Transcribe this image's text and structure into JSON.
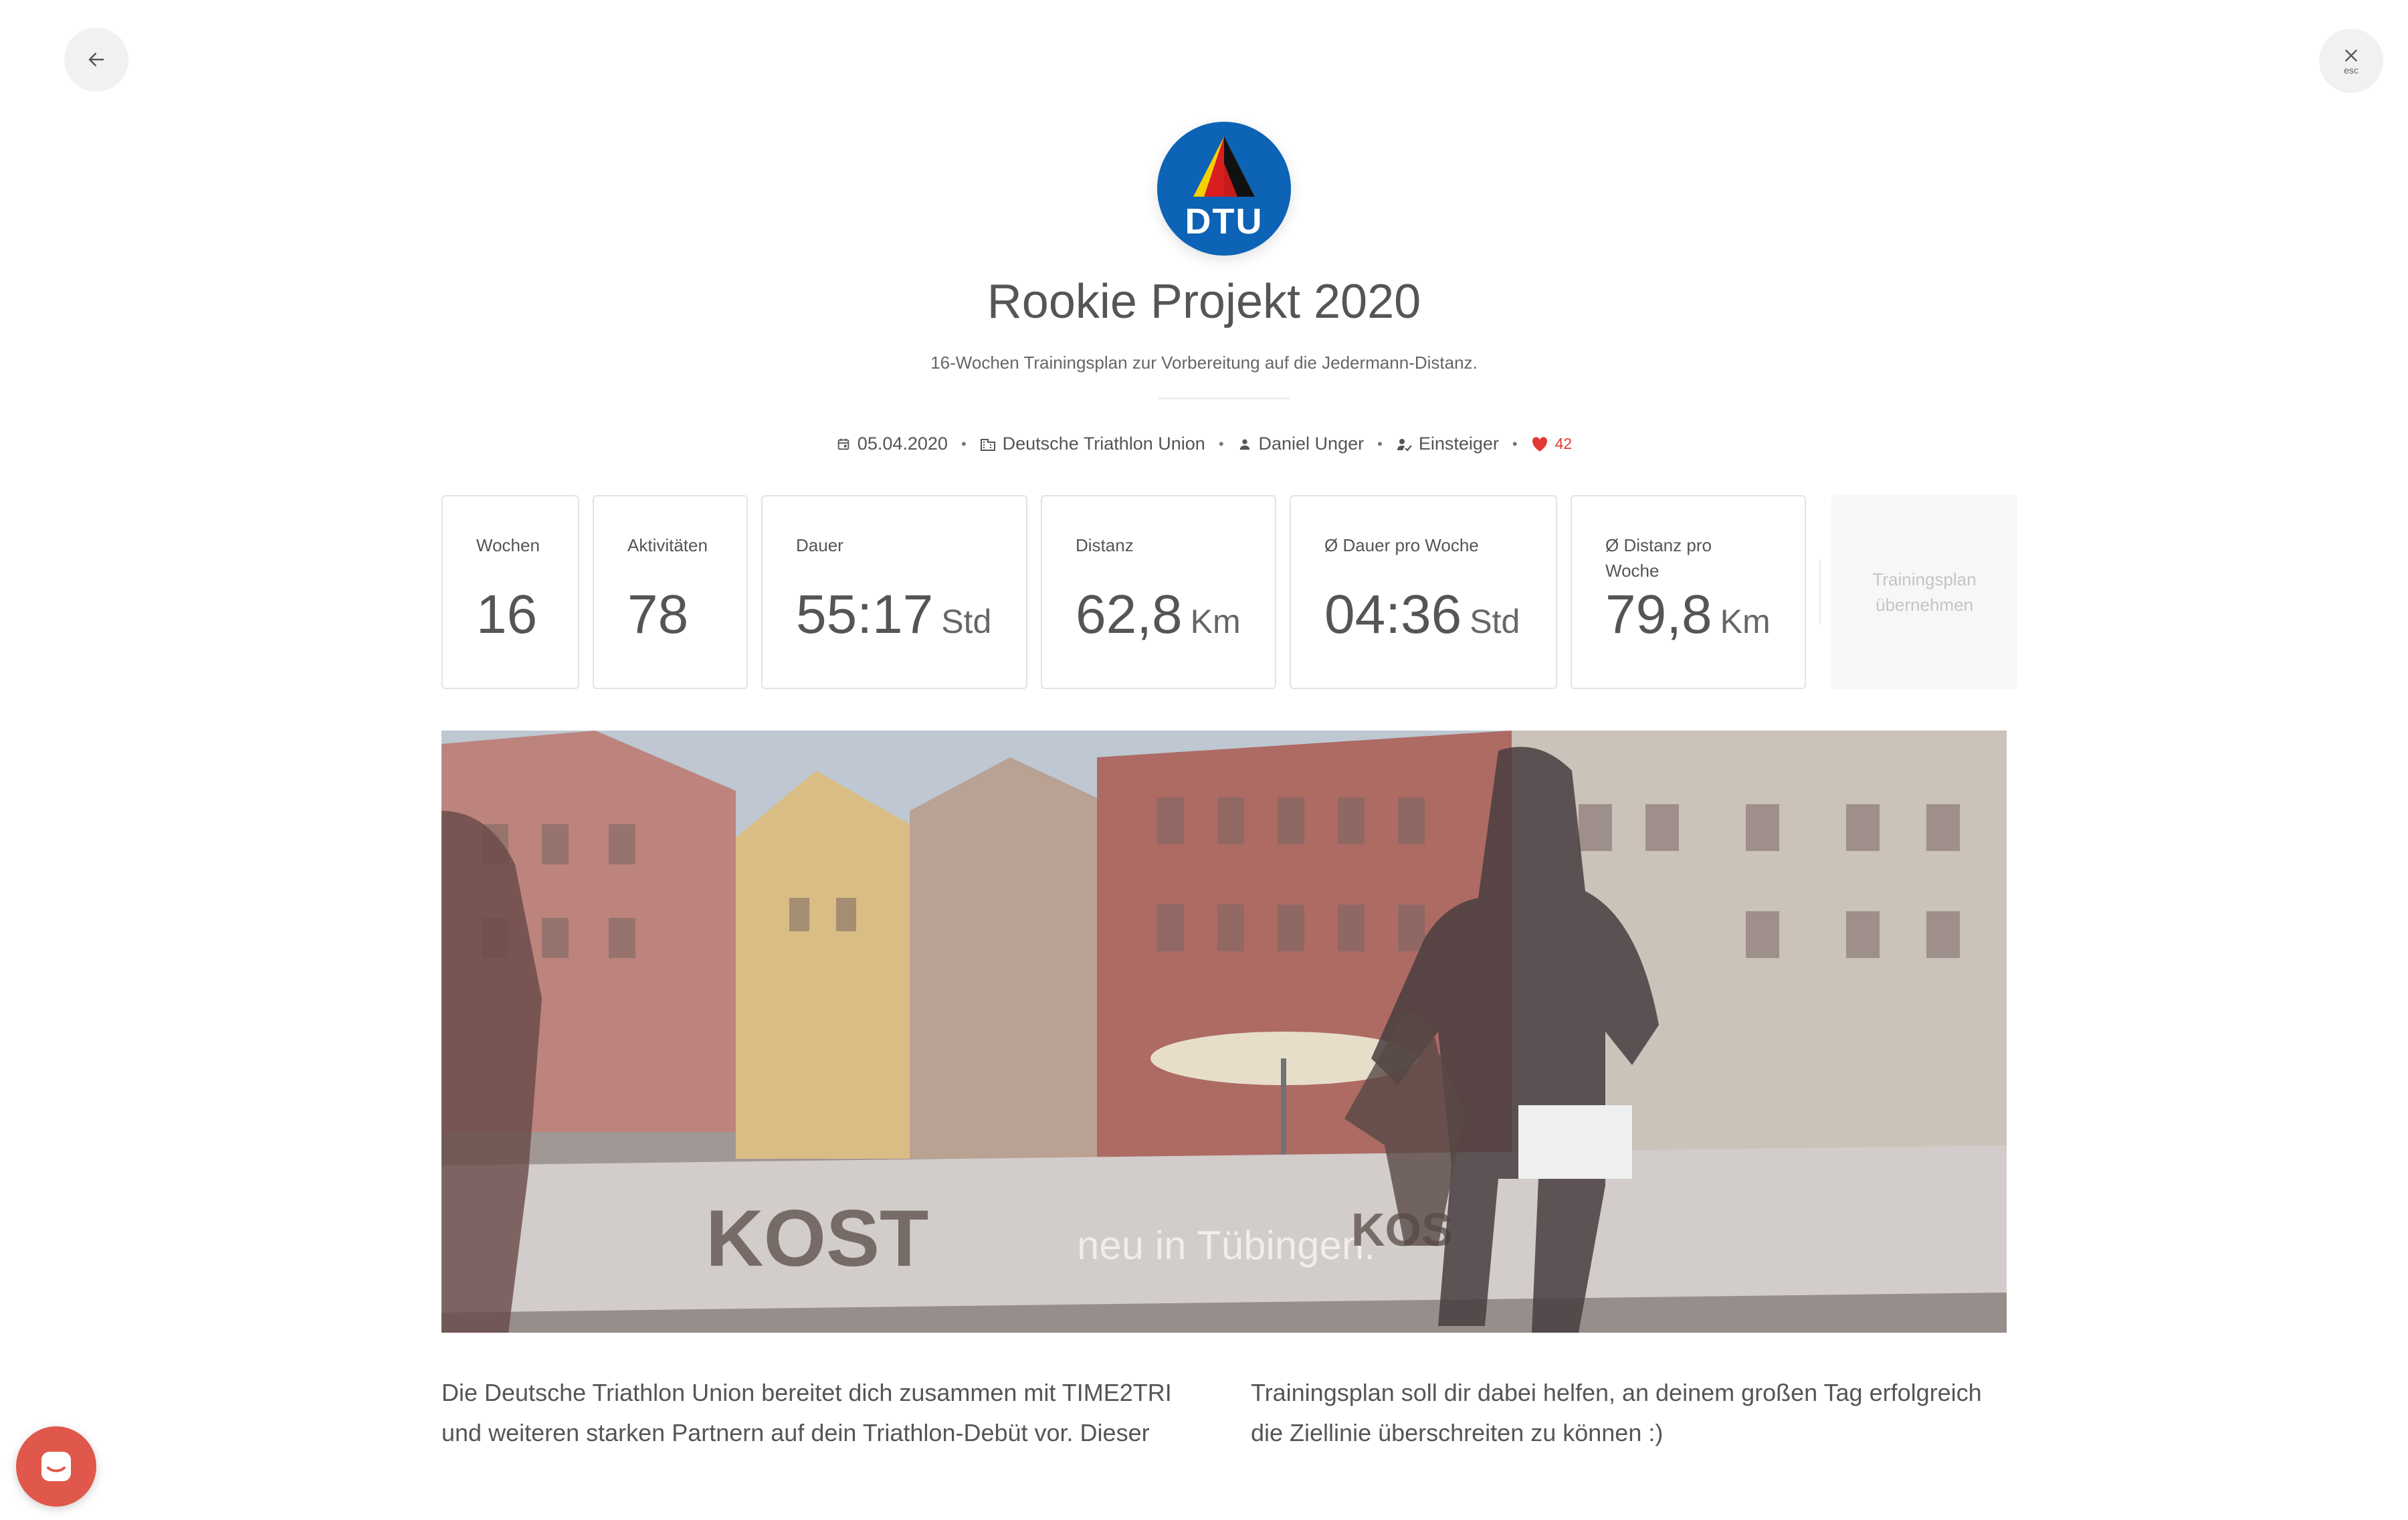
{
  "nav": {
    "back_icon": "arrow-left-icon",
    "close_icon": "close-icon",
    "close_hint": "esc"
  },
  "plan": {
    "logo_text": "DTU",
    "title": "Rookie Projekt 2020",
    "subtitle": "16-Wochen Trainingsplan zur Vorbereitung auf die Jedermann-Distanz."
  },
  "meta": {
    "date": "05.04.2020",
    "organization": "Deutsche Triathlon Union",
    "author": "Daniel Unger",
    "level": "Einsteiger",
    "likes": "42"
  },
  "stats": [
    {
      "label": "Wochen",
      "value": "16",
      "unit": ""
    },
    {
      "label": "Aktivitäten",
      "value": "78",
      "unit": ""
    },
    {
      "label": "Dauer",
      "value": "55:17",
      "unit": "Std"
    },
    {
      "label": "Distanz",
      "value": "62,8",
      "unit": "Km"
    },
    {
      "label": "Ø Dauer pro Woche",
      "value": "04:36",
      "unit": "Std"
    },
    {
      "label": "Ø Distanz pro Woche",
      "value": "79,8",
      "unit": "Km"
    }
  ],
  "adopt_button": "Trainingsplan übernehmen",
  "hero_banner": {
    "left": "KOST",
    "middle": "neu in Tübingen.",
    "right": "KOS"
  },
  "description": {
    "col1": "Die Deutsche Triathlon Union bereitet dich zusammen mit TIME2TRI und weiteren starken Partnern auf dein Triathlon-Debüt vor. Dieser",
    "col2": "Trainingsplan soll dir dabei helfen, an deinem großen Tag erfolgreich die Ziellinie überschreiten zu können :)"
  },
  "colors": {
    "brand_blue": "#0d63b5",
    "like_red": "#e53935",
    "chat_button": "#e0584b"
  }
}
